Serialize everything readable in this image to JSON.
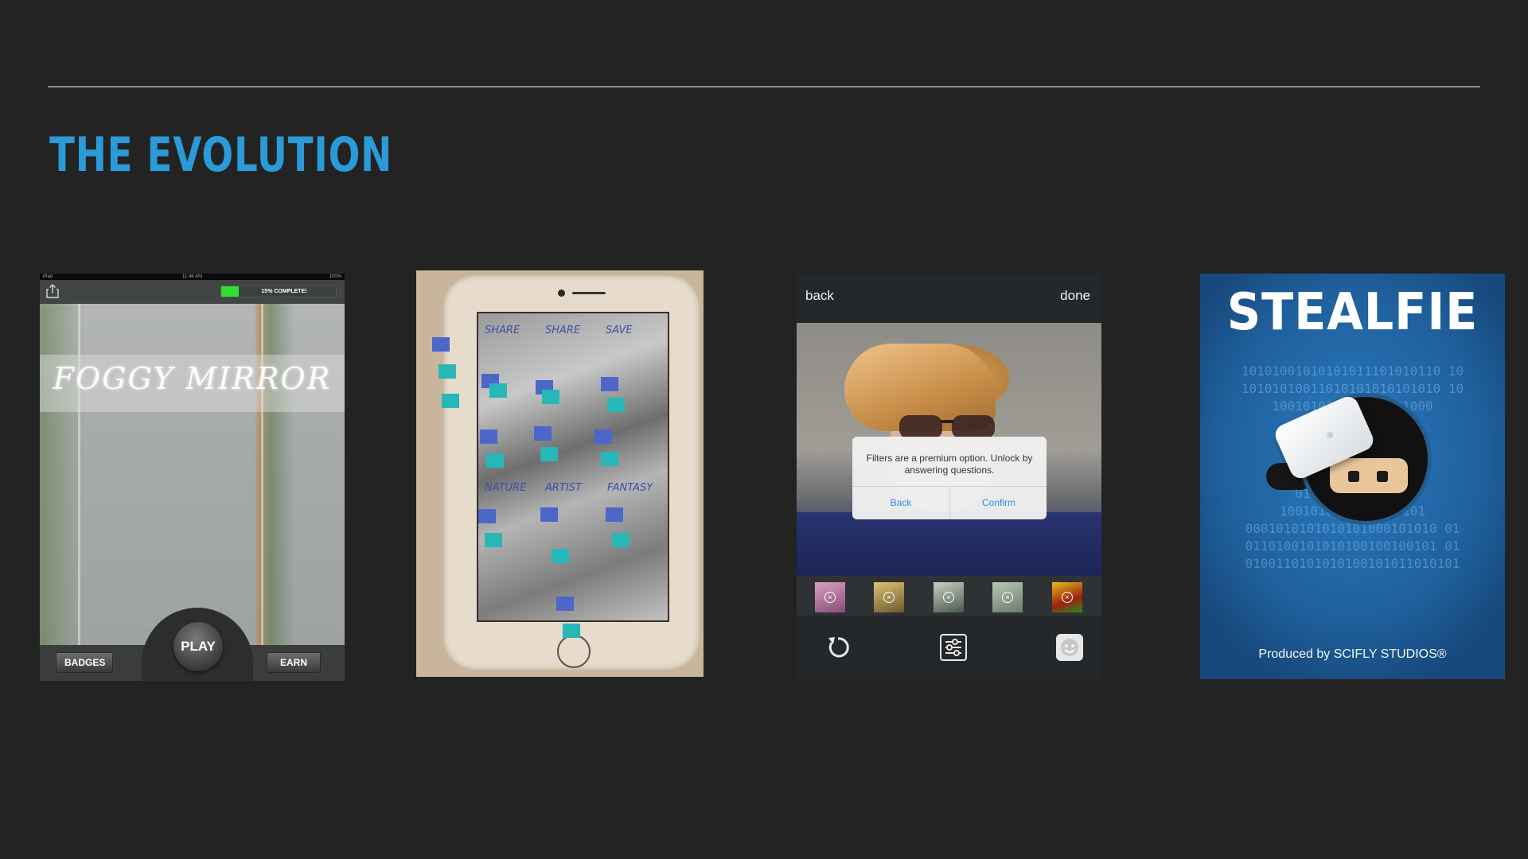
{
  "slide": {
    "title": "THE EVOLUTION",
    "accent_color": "#2a9ad8",
    "background": "#232323"
  },
  "foggy_mirror": {
    "status_left": "iPad",
    "status_time": "11:46 AM",
    "status_battery": "100%",
    "share_icon": "share-icon",
    "progress_label": "15% COMPLETE!",
    "progress_fraction": 0.15,
    "logo_text": "Foggy Mirror",
    "play_label": "PLAY",
    "badges_label": "BADGES",
    "earn_label": "EARN"
  },
  "paper_prototype": {
    "labels": [
      "SHARE",
      "SHARE",
      "SAVE",
      "NATURE",
      "ARTIST",
      "FANTASY"
    ]
  },
  "selfie_app": {
    "back_label": "back",
    "done_label": "done",
    "dialog_message": "Filters are a premium option. Unlock by answering questions.",
    "dialog_back": "Back",
    "dialog_confirm": "Confirm",
    "filter_thumb_count": 5,
    "tools": [
      "rotate-icon",
      "adjust-sliders-icon",
      "face-icon"
    ]
  },
  "stealfie": {
    "title": "STEALFIE",
    "binary_lines": [
      "10101001010101011101010110 10",
      "10101010011010101010101010 10",
      "100101010      10100101000",
      "1010101            010110",
      "1001                  100010",
      "101                     101101",
      "00                      001101",
      "0110100              0001010",
      "1001010101      10010101",
      "0001010101010101000101010 01",
      "0110100101010100100100101 01",
      "0100110101010100101011010101"
    ],
    "produced_by": "Produced by SCIFLY STUDIOS®"
  }
}
